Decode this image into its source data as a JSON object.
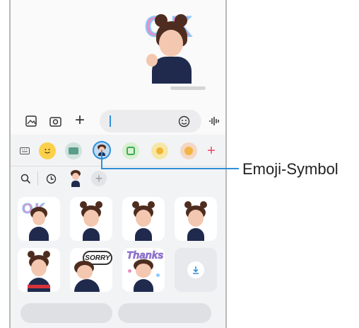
{
  "callout": {
    "label": "Emoji-Symbol"
  },
  "chat": {
    "sticker_text": "OK"
  },
  "compose": {
    "input_value": ""
  },
  "stickers": {
    "sorry_text": "SORRY",
    "thanks_text": "Thanks"
  },
  "icons": {
    "gallery": "image-icon",
    "camera": "camera-icon",
    "add": "plus-icon",
    "emoji": "smiley-icon",
    "voice": "voice-waveform-icon"
  },
  "colors": {
    "accent": "#2f8fd8",
    "plus": "#e8475f"
  }
}
